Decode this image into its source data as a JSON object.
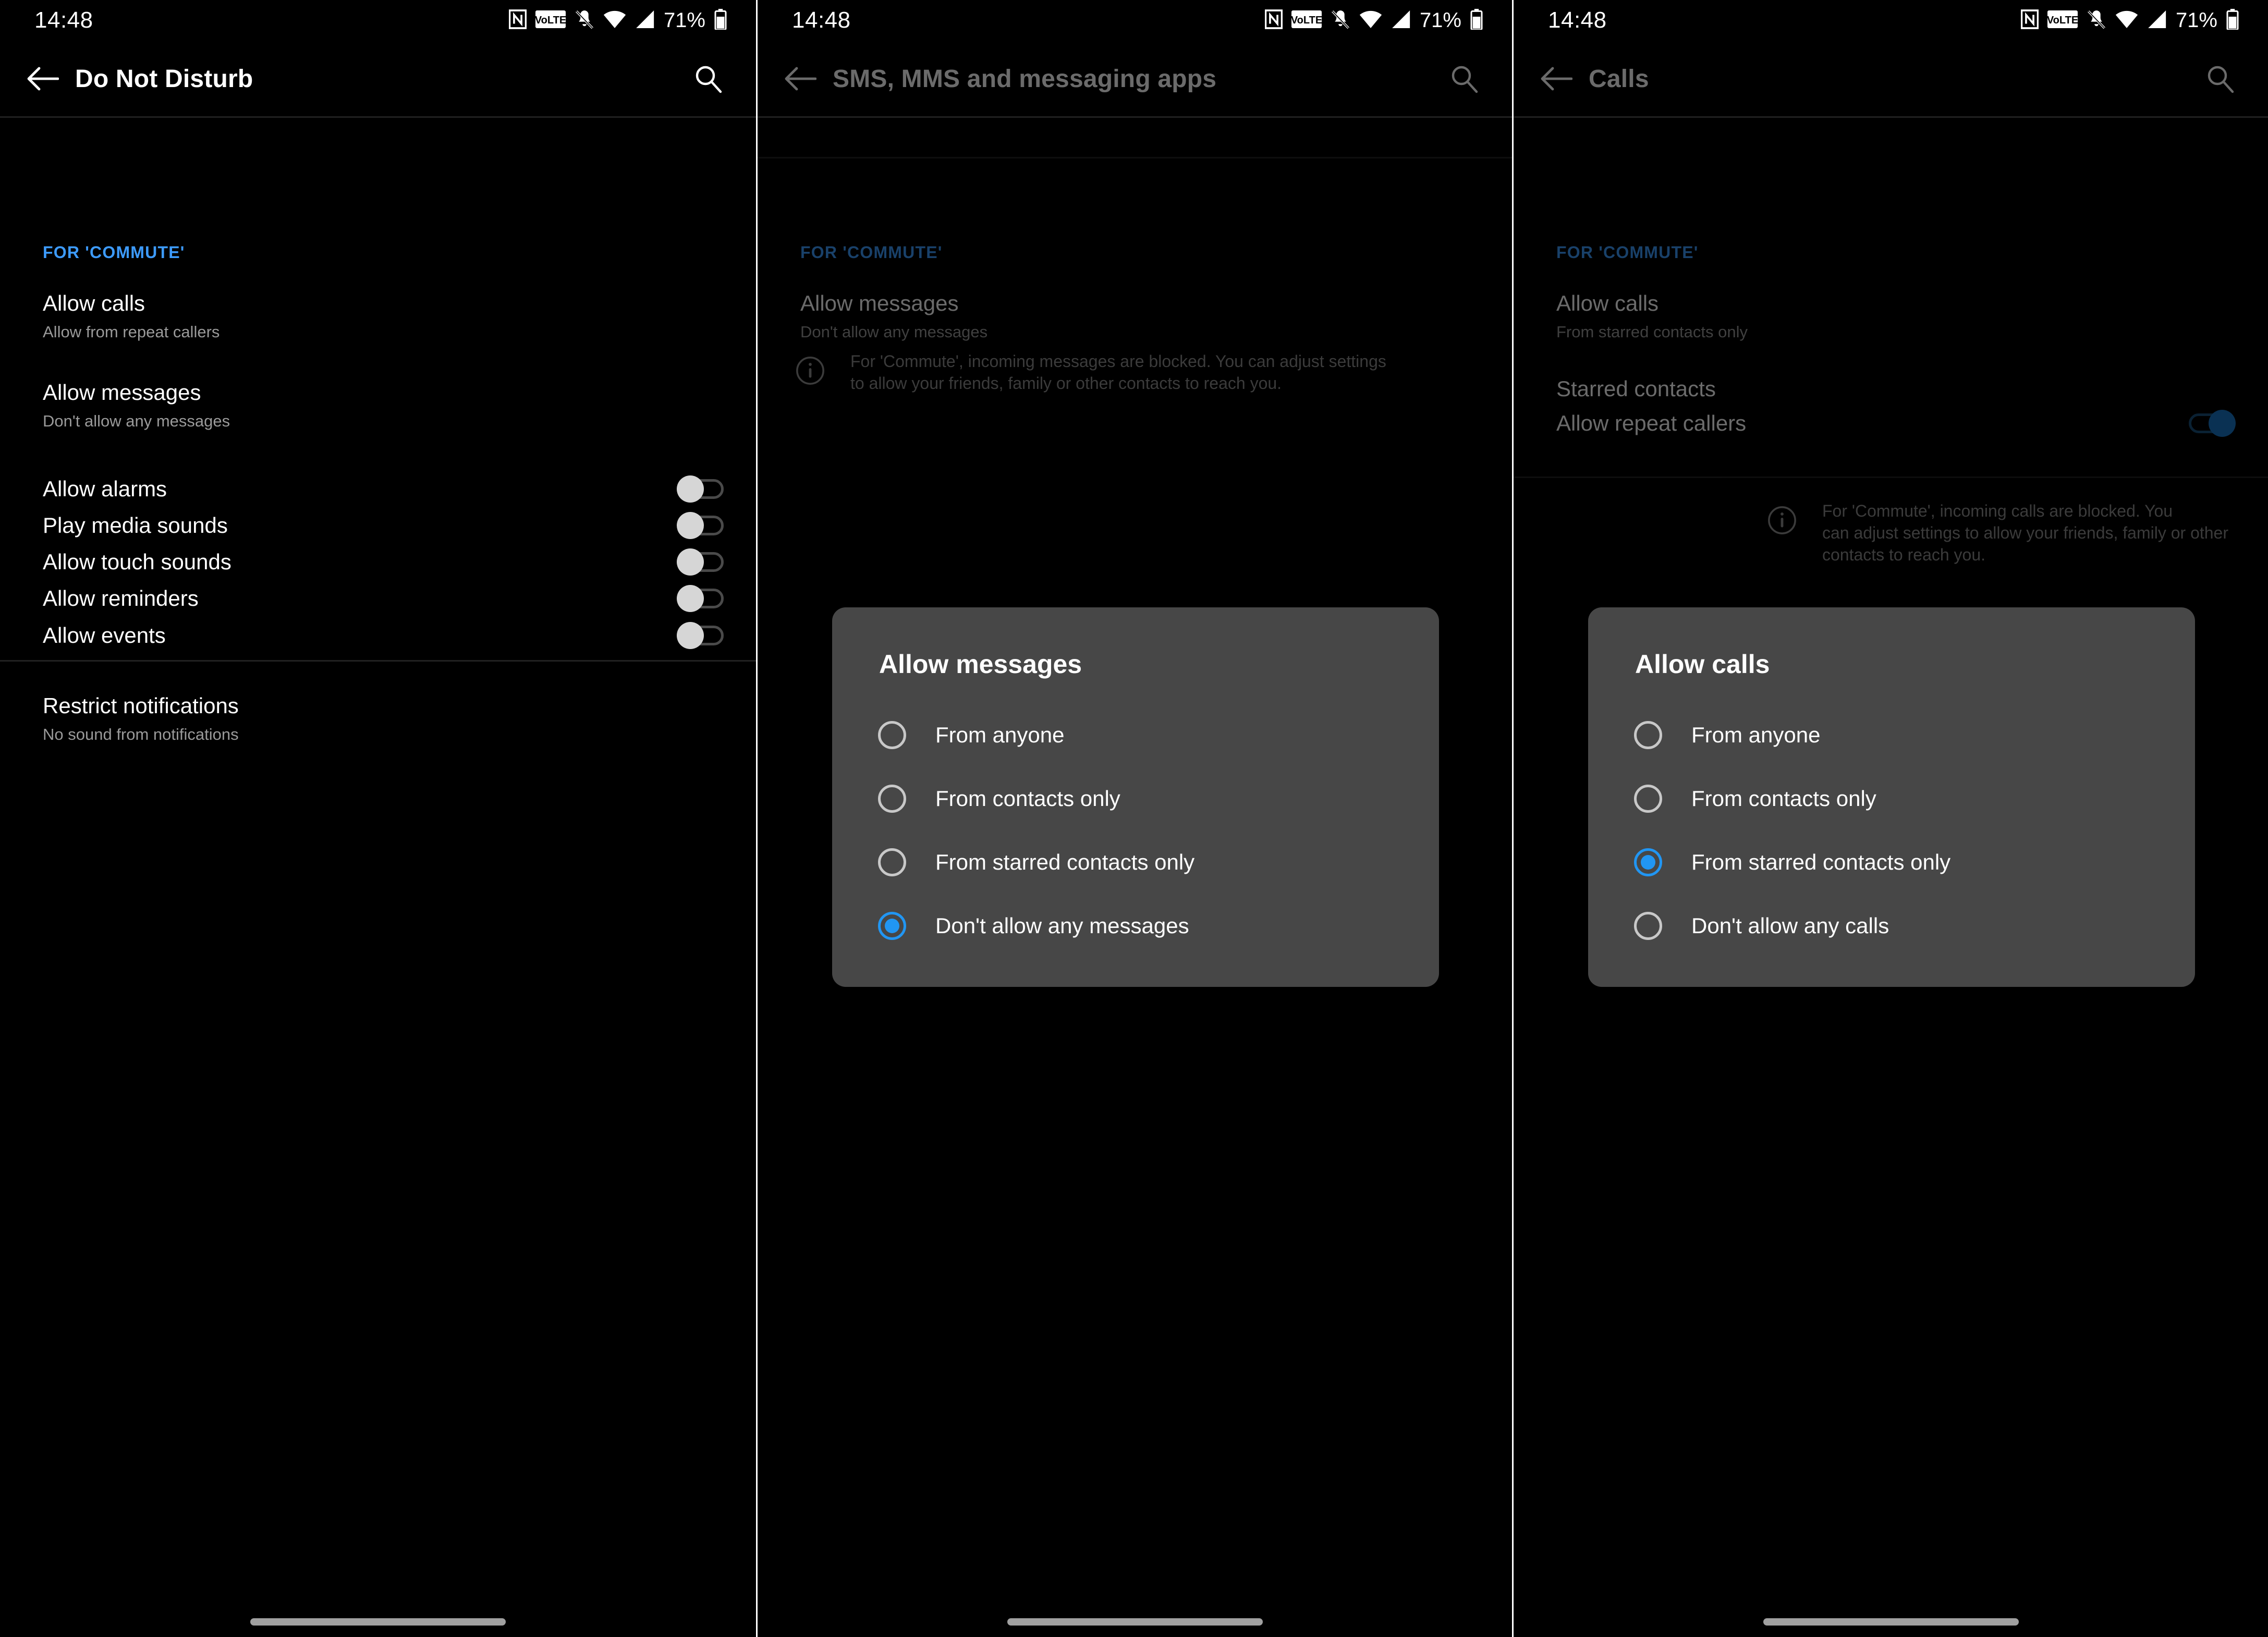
{
  "status_bar": {
    "time": "14:48",
    "battery_percent": "71%",
    "icons": [
      "nfc-icon",
      "volte-icon",
      "notifications-off-icon",
      "wifi-icon",
      "cellular-signal-icon",
      "battery-icon"
    ]
  },
  "accent_colors": {
    "section_label_blue": "#3d9bfd",
    "radio_selected_blue": "#2196f3",
    "switch_on_blue": "#1976c7",
    "dialog_background": "#474747"
  },
  "panel1": {
    "title": "Do Not Disturb",
    "section_label": "FOR 'COMMUTE'",
    "rows": [
      {
        "title": "Allow calls",
        "subtitle": "Allow from repeat callers",
        "has_switch": false
      },
      {
        "title": "Allow messages",
        "subtitle": "Don't allow any messages",
        "has_switch": false
      },
      {
        "title": "Allow alarms",
        "subtitle": "",
        "has_switch": true,
        "switch_on": false
      },
      {
        "title": "Play media sounds",
        "subtitle": "",
        "has_switch": true,
        "switch_on": false
      },
      {
        "title": "Allow touch sounds",
        "subtitle": "",
        "has_switch": true,
        "switch_on": false
      },
      {
        "title": "Allow reminders",
        "subtitle": "",
        "has_switch": true,
        "switch_on": false
      },
      {
        "title": "Allow events",
        "subtitle": "",
        "has_switch": true,
        "switch_on": false
      },
      {
        "title": "Restrict notifications",
        "subtitle": "No sound from notifications",
        "has_switch": false
      }
    ]
  },
  "panel2": {
    "title": "SMS, MMS and messaging apps",
    "section_label": "FOR 'COMMUTE'",
    "rows": [
      {
        "title": "Allow messages",
        "subtitle": "Don't allow any messages"
      }
    ],
    "info_text": "For 'Commute', incoming messages are blocked. You can adjust settings to allow your friends, family or other contacts to reach you.",
    "dialog": {
      "title": "Allow messages",
      "options": [
        {
          "label": "From anyone",
          "selected": false
        },
        {
          "label": "From contacts only",
          "selected": false
        },
        {
          "label": "From starred contacts only",
          "selected": false
        },
        {
          "label": "Don't allow any messages",
          "selected": true
        }
      ]
    }
  },
  "panel3": {
    "title": "Calls",
    "section_label": "FOR 'COMMUTE'",
    "rows": [
      {
        "title": "Allow calls",
        "subtitle": "From starred contacts only",
        "has_switch": false
      },
      {
        "title": "Starred contacts",
        "subtitle": "",
        "has_switch": false
      },
      {
        "title": "Allow repeat callers",
        "subtitle": "",
        "has_switch": true,
        "switch_on": true
      }
    ],
    "info_text_fragment_1": "can",
    "info_text_fragment_2": "ther",
    "dialog": {
      "title": "Allow calls",
      "options": [
        {
          "label": "From anyone",
          "selected": false
        },
        {
          "label": "From contacts only",
          "selected": false
        },
        {
          "label": "From starred contacts only",
          "selected": true
        },
        {
          "label": "Don't allow any calls",
          "selected": false
        }
      ]
    }
  }
}
